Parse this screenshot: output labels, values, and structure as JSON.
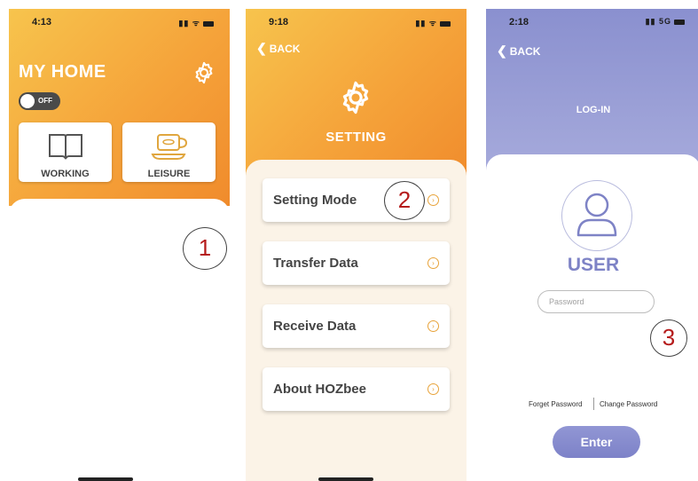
{
  "screens": {
    "home": {
      "time": "4:13",
      "status_icons": "▮▮ ᯤ",
      "title": "MY HOME",
      "toggle_label": "OFF",
      "modes": [
        {
          "label": "WORKING",
          "icon": "book-icon"
        },
        {
          "label": "LEISURE",
          "icon": "coffee-cup-icon"
        }
      ],
      "marker": "1"
    },
    "setting": {
      "time": "9:18",
      "status_icons": "▮▮ ᯤ",
      "back_label": "BACK",
      "title": "SETTING",
      "menu": [
        {
          "label": "Setting Mode"
        },
        {
          "label": "Transfer Data"
        },
        {
          "label": "Receive Data"
        },
        {
          "label": "About HOZbee"
        }
      ],
      "marker": "2"
    },
    "login": {
      "time": "2:18",
      "status_icons": "▮▮ 5G",
      "back_label": "BACK",
      "title": "LOG-IN",
      "user_label": "USER",
      "password_placeholder": "Password",
      "forget_password": "Forget Password",
      "change_password": "Change Password",
      "enter_label": "Enter",
      "marker": "3"
    }
  },
  "colors": {
    "orange_gradient_start": "#f7c44d",
    "orange_gradient_end": "#f08b2c",
    "purple": "#8a90cf",
    "cream": "#fbf3e7",
    "marker_red": "#b51b1b"
  }
}
